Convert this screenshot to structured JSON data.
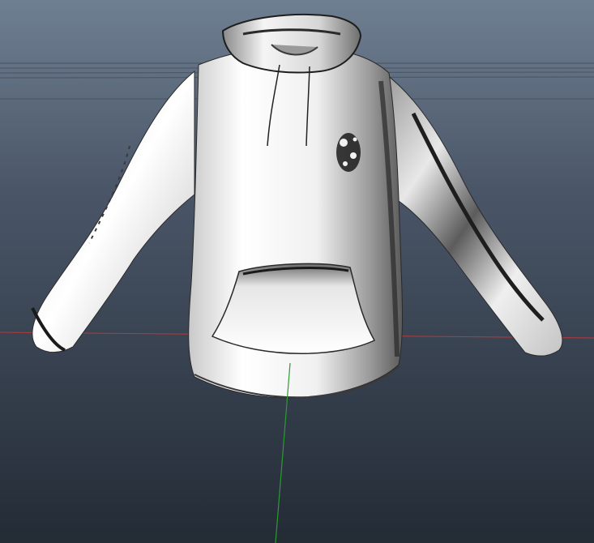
{
  "viewport": {
    "background_top": "#6f7f92",
    "background_bottom": "#232b35"
  },
  "model": {
    "icon": "hoodie-3d-model",
    "color": "#f2f2f2",
    "chest_print_icon": "floral-emblem-print"
  },
  "axes": {
    "x_axis_color": "#b83a3a",
    "y_axis_color": "#2e9a34",
    "grid_line_color": "#4a5361"
  }
}
